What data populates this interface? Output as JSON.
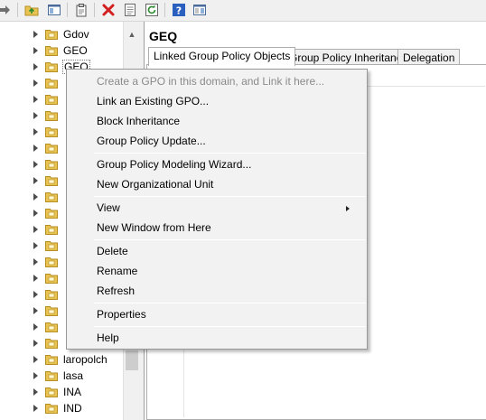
{
  "toolbar": {
    "buttons": [
      {
        "icon": "forward-arrow-icon"
      },
      {
        "icon": "up-folder-icon"
      },
      {
        "icon": "show-hide-tree-icon"
      },
      {
        "icon": "clipboard-icon"
      },
      {
        "icon": "delete-icon"
      },
      {
        "icon": "properties-icon"
      },
      {
        "icon": "refresh-icon"
      },
      {
        "icon": "help-icon"
      },
      {
        "icon": "action-pane-icon"
      }
    ]
  },
  "tree": {
    "items": [
      {
        "label": "Gdov"
      },
      {
        "label": "GEO"
      },
      {
        "label": "GEQ",
        "selected": true
      },
      {
        "label": ""
      },
      {
        "label": ""
      },
      {
        "label": ""
      },
      {
        "label": ""
      },
      {
        "label": ""
      },
      {
        "label": ""
      },
      {
        "label": ""
      },
      {
        "label": ""
      },
      {
        "label": ""
      },
      {
        "label": ""
      },
      {
        "label": ""
      },
      {
        "label": ""
      },
      {
        "label": ""
      },
      {
        "label": ""
      },
      {
        "label": ""
      },
      {
        "label": ""
      },
      {
        "label": ""
      },
      {
        "label": "laropolch"
      },
      {
        "label": "lasa"
      },
      {
        "label": "INA"
      },
      {
        "label": "IND"
      }
    ]
  },
  "details": {
    "title": "GEQ",
    "tabs": [
      "Linked Group Policy Objects",
      "Group Policy Inheritance",
      "Delegation"
    ],
    "active_tab": "Linked Group Policy Objects"
  },
  "context_menu": {
    "items": [
      {
        "label": "Create a GPO in this domain, and Link it here...",
        "disabled": true
      },
      {
        "label": "Link an Existing GPO..."
      },
      {
        "label": "Block Inheritance"
      },
      {
        "label": "Group Policy Update..."
      },
      {
        "label": "Group Policy Modeling Wizard..."
      },
      {
        "label": "New Organizational Unit"
      },
      {
        "label": "View",
        "submenu": true
      },
      {
        "label": "New Window from Here"
      },
      {
        "label": "Delete"
      },
      {
        "label": "Rename"
      },
      {
        "label": "Refresh"
      },
      {
        "label": "Properties"
      },
      {
        "label": "Help"
      }
    ]
  },
  "colors": {
    "folder": "#e8c352",
    "folder_edge": "#b58e22",
    "delete_red": "#d21f1f",
    "help_blue": "#2b5fbf"
  }
}
